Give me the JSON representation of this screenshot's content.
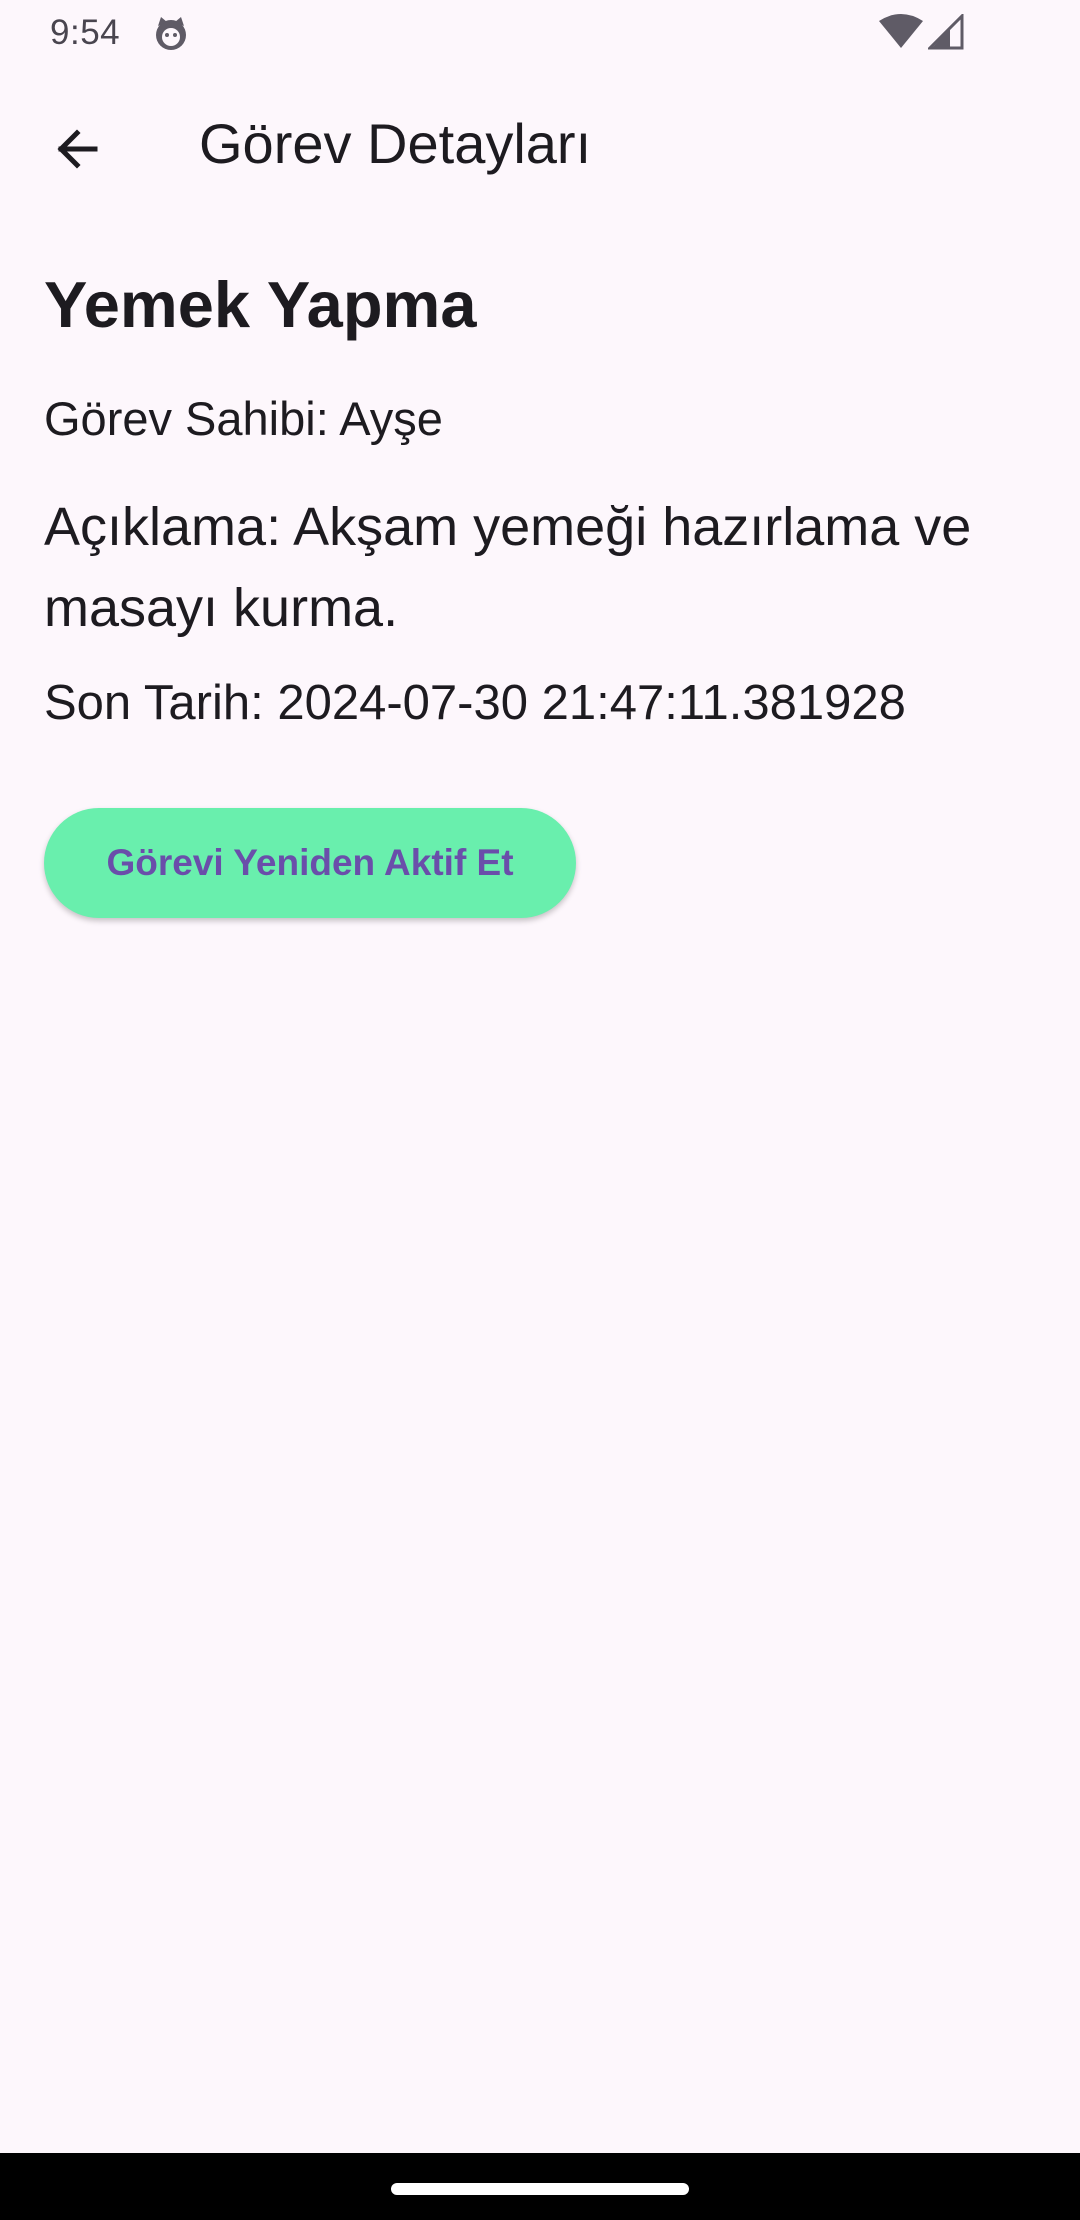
{
  "status_bar": {
    "time": "9:54",
    "app_icon": "cat-face-icon",
    "wifi_icon": "wifi-icon",
    "signal_icon": "cellular-signal-icon"
  },
  "app_bar": {
    "back_icon": "arrow-back-icon",
    "title": "Görev Detayları"
  },
  "task": {
    "title": "Yemek Yapma",
    "owner_label": "Görev Sahibi: ",
    "owner_value": "Ayşe",
    "description_label": "Açıklama: ",
    "description_value": "Akşam yemeği hazırlama ve masayı kurma.",
    "deadline_label": "Son Tarih: ",
    "deadline_value": "2024-07-30 21:47:11.381928"
  },
  "actions": {
    "reactivate_label": "Görevi Yeniden Aktif Et"
  },
  "colors": {
    "background": "#fdf7fc",
    "button_background": "#69efad",
    "button_text": "#6a4eaa",
    "text_primary": "#1d1b20"
  }
}
